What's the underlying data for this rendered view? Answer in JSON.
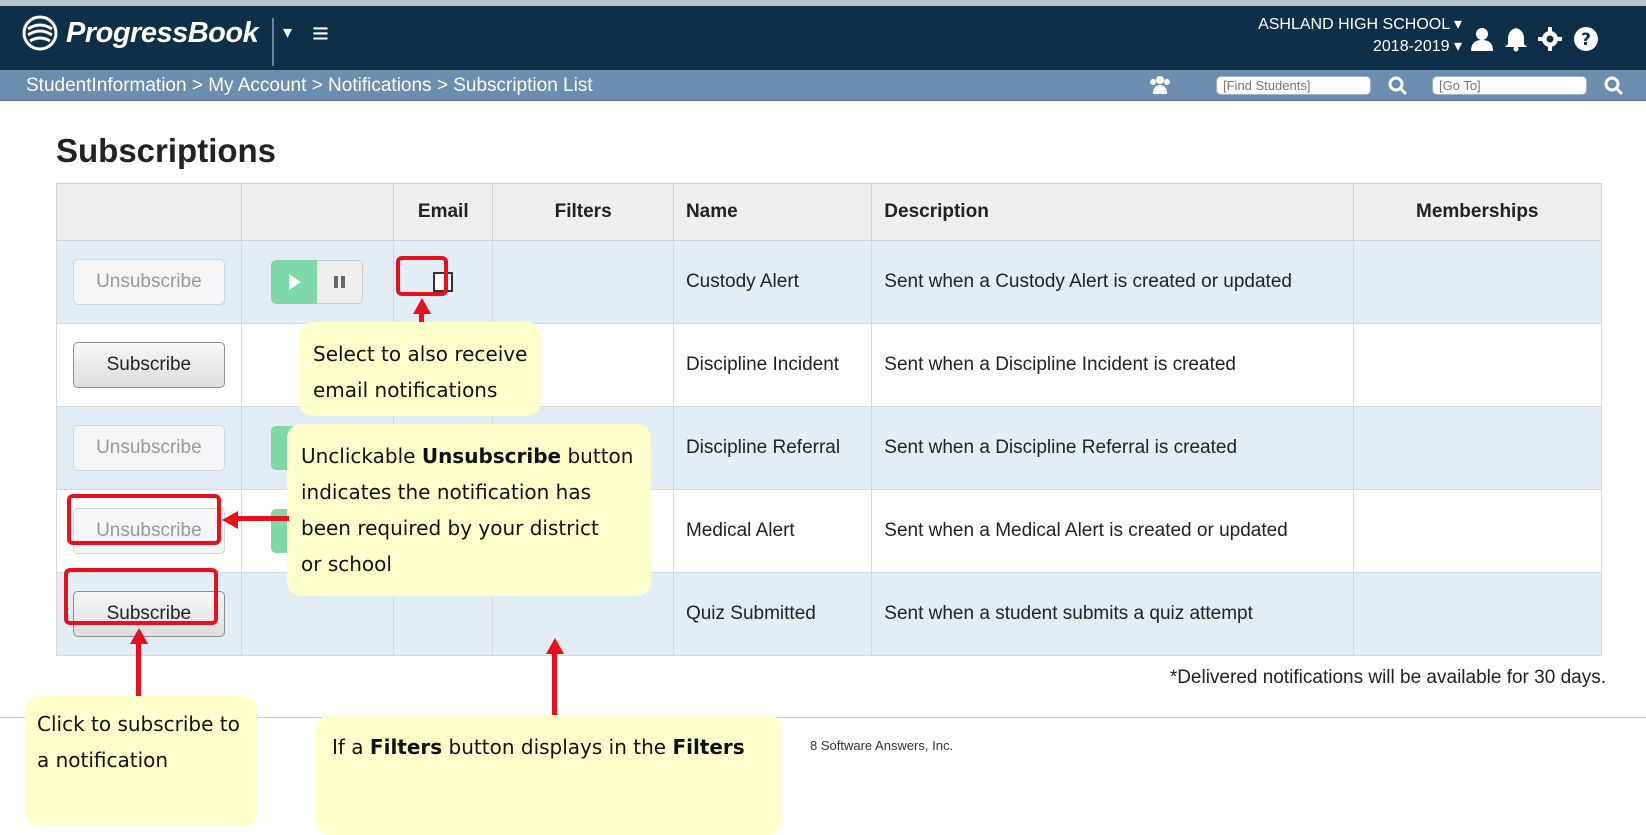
{
  "app": {
    "logo_text": "ProgressBook",
    "school": "ASHLAND HIGH SCHOOL",
    "year": "2018-2019"
  },
  "breadcrumb": "StudentInformation > My Account > Notifications > Subscription List",
  "search": {
    "find_placeholder": "[Find Students]",
    "goto_placeholder": "[Go To]"
  },
  "page_title": "Subscriptions",
  "table": {
    "headers": [
      "",
      "",
      "Email",
      "Filters",
      "Name",
      "Description",
      "Memberships"
    ],
    "rows": [
      {
        "button": "Unsubscribe",
        "button_state": "disabled",
        "show_playpause": true,
        "email_checkbox": true,
        "filters": "",
        "name": "Custody Alert",
        "description": "Sent when a Custody Alert is created or updated",
        "memberships": ""
      },
      {
        "button": "Subscribe",
        "button_state": "enabled",
        "show_playpause": false,
        "email_checkbox": false,
        "filters": "",
        "name": "Discipline Incident",
        "description": "Sent when a Discipline Incident is created",
        "memberships": ""
      },
      {
        "button": "Unsubscribe",
        "button_state": "disabled",
        "show_playpause": true,
        "email_checkbox": true,
        "filters": "",
        "name": "Discipline Referral",
        "description": "Sent when a Discipline Referral is created",
        "memberships": ""
      },
      {
        "button": "Unsubscribe",
        "button_state": "disabled",
        "show_playpause": true,
        "email_checkbox": true,
        "filters": "",
        "name": "Medical Alert",
        "description": "Sent when a Medical Alert is created or updated",
        "memberships": ""
      },
      {
        "button": "Subscribe",
        "button_state": "enabled",
        "show_playpause": false,
        "email_checkbox": false,
        "filters": "",
        "name": "Quiz Submitted",
        "description": "Sent when a student submits a quiz attempt",
        "memberships": ""
      }
    ]
  },
  "note": "*Delivered notifications will be available for 30 days.",
  "copyright": "8 Software Answers, Inc.",
  "callouts": {
    "email": [
      "Select to also receive",
      "email notifications"
    ],
    "unclickable": {
      "line1_pre": "Unclickable ",
      "line1_bold": "Unsubscribe",
      "line1_post": " button",
      "line2": "indicates the notification has",
      "line3": "been required by your district",
      "line4": "or school"
    },
    "subscribe": [
      "Click to subscribe to",
      "a notification"
    ],
    "filters": {
      "pre": "If a ",
      "bold1": "Filters",
      "mid": " button displays in the ",
      "bold2": "Filters"
    }
  },
  "colors": {
    "header_bg": "#0d2f47",
    "breadcrumb_bg": "#6c8eae",
    "callout_bg": "#ffffcc",
    "highlight_red": "#e8101c",
    "play_green": "#7fd8a8"
  }
}
